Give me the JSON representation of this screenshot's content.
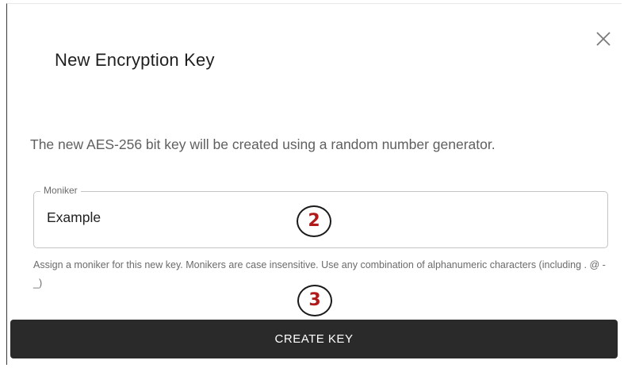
{
  "dialog": {
    "title": "New Encryption Key",
    "close_icon": "close-icon",
    "description": "The new AES-256 bit key will be created using a random number generator.",
    "moniker_field": {
      "label": "Moniker",
      "value": "Example",
      "helper": "Assign a moniker for this new key. Monikers are case insensitive. Use any combination of alphanumeric characters (including . @ - _)"
    },
    "callouts": [
      "2",
      "3"
    ],
    "create_button_label": "CREATE KEY"
  },
  "colors": {
    "button_bg": "#2a2a2a",
    "callout_number": "#b01a1a"
  }
}
